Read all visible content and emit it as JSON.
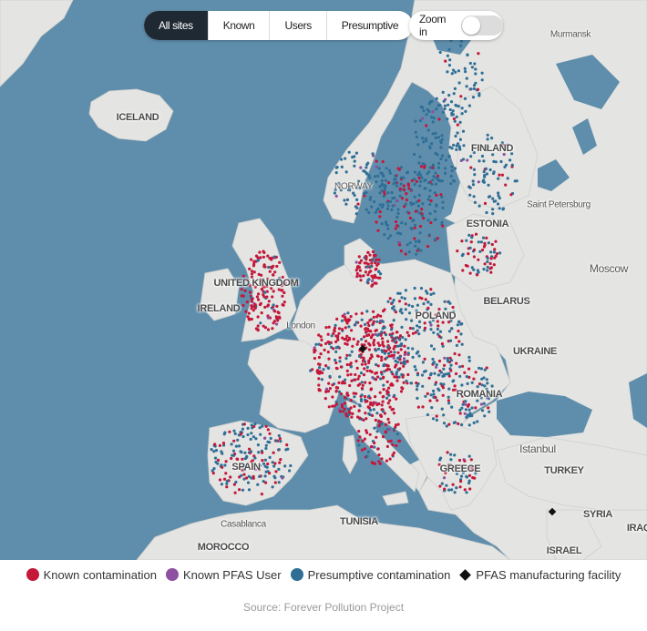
{
  "filters": {
    "tabs": [
      {
        "label": "All sites",
        "active": true
      },
      {
        "label": "Known",
        "active": false
      },
      {
        "label": "Users",
        "active": false
      },
      {
        "label": "Presumptive",
        "active": false
      }
    ]
  },
  "zoom": {
    "label": "Zoom in",
    "enabled": false
  },
  "map_labels": {
    "iceland": "ICELAND",
    "finland": "FINLAND",
    "norway": "NORWAY",
    "estonia": "ESTONIA",
    "saint_petersburg": "Saint Petersburg",
    "murmansk": "Murmansk",
    "moscow": "Moscow",
    "united_kingdom": "UNITED KINGDOM",
    "ireland": "IRELAND",
    "london": "London",
    "belarus": "BELARUS",
    "poland": "POLAND",
    "ukraine": "UKRAINE",
    "romania": "ROMANIA",
    "istanbul": "Istanbul",
    "turkey": "TURKEY",
    "greece": "GREECE",
    "spain": "SPAIN",
    "tunisia": "TUNISIA",
    "casablanca": "Casablanca",
    "morocco": "MOROCCO",
    "syria": "SYRIA",
    "iraq": "IRAQ",
    "israel": "ISRAEL"
  },
  "legend": {
    "known": {
      "label": "Known contamination",
      "color": "#c4173a"
    },
    "user": {
      "label": "Known PFAS User",
      "color": "#8e4fa0"
    },
    "presumptive": {
      "label": "Presumptive contamination",
      "color": "#2f6f96"
    },
    "manufacturing": {
      "label": "PFAS manufacturing facility",
      "color": "#111111"
    }
  },
  "colors": {
    "sea": "#5f8eac",
    "land": "#e4e4e2",
    "border": "#b8b8b8"
  },
  "source": "Source: Forever Pollution Project"
}
